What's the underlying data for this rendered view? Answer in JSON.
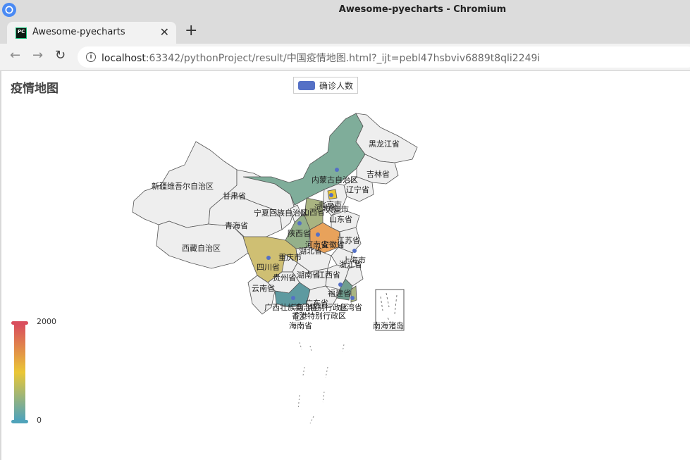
{
  "window": {
    "title": "Awesome-pyecharts - Chromium"
  },
  "tab": {
    "title": "Awesome-pyecharts",
    "close": "✕",
    "new": "+"
  },
  "toolbar": {
    "back": "←",
    "forward": "→",
    "reload": "↻",
    "url_host": "localhost",
    "url_rest": ":63342/pythonProject/result/中国疫情地图.html?_ijt=pebl47hsbviv6889t8qli2249i"
  },
  "chart_data": {
    "type": "map",
    "title": "疫情地图",
    "legend": [
      "确诊人数"
    ],
    "visual_map": {
      "min": 0,
      "max": 2000,
      "min_label": "0",
      "max_label": "2000"
    },
    "colors": {
      "legend": "#5470c6",
      "range": [
        "#50a3ba",
        "#eac736",
        "#d94e5d"
      ],
      "empty": "#eeeeee"
    },
    "province_labels": [
      "黑龙江省",
      "吉林省",
      "辽宁省",
      "内蒙古自治区",
      "新疆维吾尔自治区",
      "甘肃省",
      "宁夏回族自治区",
      "山西省",
      "北京市",
      "天津市",
      "河北省",
      "山东省",
      "青海省",
      "陕西省",
      "河南省",
      "安徽省",
      "江苏省",
      "上海市",
      "湖北省",
      "浙江省",
      "西藏自治区",
      "四川省",
      "重庆市",
      "贵州省",
      "湖南省",
      "江西省",
      "福建省",
      "云南省",
      "广西壮族自治区",
      "广东省",
      "澳门特别行政区",
      "台湾省",
      "香港特别行政区",
      "海南省",
      "南海诸岛"
    ]
  }
}
